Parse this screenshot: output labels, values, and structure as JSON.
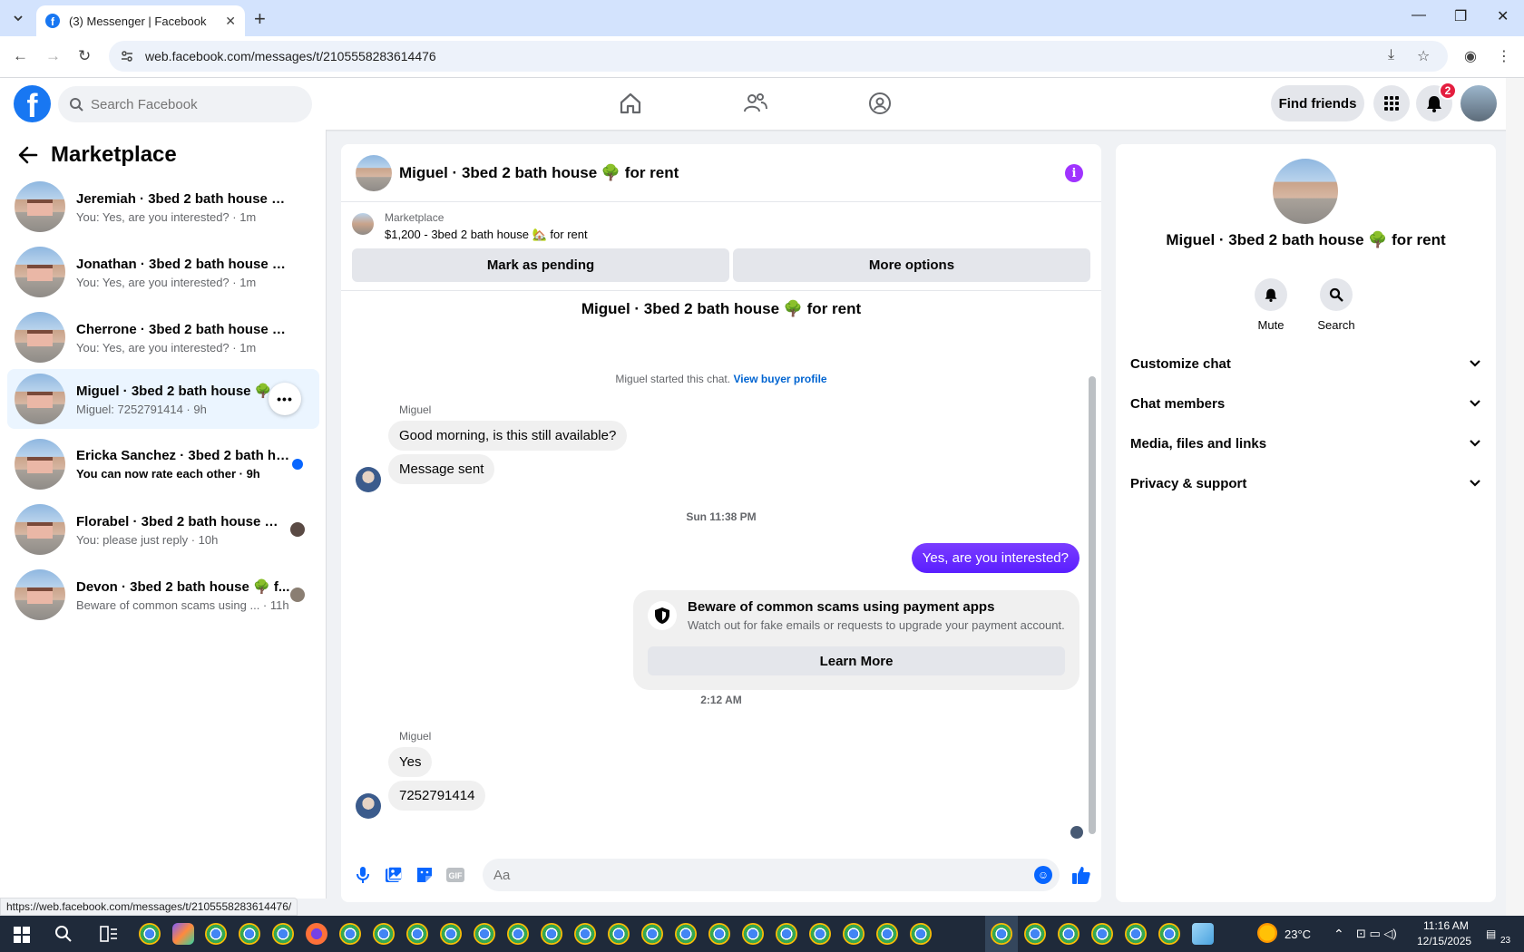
{
  "browser": {
    "tab_title": "(3) Messenger | Facebook",
    "url": "web.facebook.com/messages/t/2105558283614476",
    "status_url": "https://web.facebook.com/messages/t/2105558283614476/"
  },
  "fb": {
    "search_placeholder": "Search Facebook",
    "find_friends": "Find friends",
    "notif_count": "2"
  },
  "sidebar": {
    "title": "Marketplace",
    "conversations": [
      {
        "name": "Jeremiah · 3bed 2 bath house 🌳 f...",
        "sub": "You: Yes, are you interested? · 1m"
      },
      {
        "name": "Jonathan · 3bed 2 bath house 🌳 f...",
        "sub": "You: Yes, are you interested? · 1m"
      },
      {
        "name": "Cherrone · 3bed 2 bath house 🌳 f...",
        "sub": "You: Yes, are you interested? · 1m"
      },
      {
        "name": "Miguel · 3bed 2 bath house 🌳 f...",
        "sub": "Miguel: 7252791414 · 9h"
      },
      {
        "name": "Ericka Sanchez · 3bed 2 bath ho...",
        "sub": "You can now rate each other · 9h"
      },
      {
        "name": "Florabel · 3bed 2 bath house 🌳 ...",
        "sub": "You: please just reply · 10h"
      },
      {
        "name": "Devon · 3bed 2 bath house 🌳 f...",
        "sub": "Beware of common scams using ...  · 11h"
      }
    ]
  },
  "chat": {
    "title": "Miguel · 3bed 2 bath house 🌳 for rent",
    "listing_label": "Marketplace",
    "listing_price": "$1,200 - 3bed 2 bath house 🏡 for rent",
    "mark_pending": "Mark as pending",
    "more_options": "More options",
    "center_name": "Miguel · 3bed 2 bath house 🌳 for rent",
    "started": "Miguel started this chat.",
    "view_buyer": "View buyer profile",
    "sender1": "Miguel",
    "msg1": "Good morning, is this still available?",
    "msg2": "Message sent",
    "ts1": "Sun 11:38 PM",
    "out1": "Yes, are you interested?",
    "warn_title": "Beware of common scams using payment apps",
    "warn_desc": "Watch out for fake emails or requests to upgrade your payment account.",
    "learn_more": "Learn More",
    "ts2": "2:12 AM",
    "sender2": "Miguel",
    "msg3": "Yes",
    "msg4": "7252791414",
    "composer_placeholder": "Aa"
  },
  "right": {
    "name": "Miguel · 3bed 2 bath house 🌳 for rent",
    "mute": "Mute",
    "search": "Search",
    "sections": [
      "Customize chat",
      "Chat members",
      "Media, files and links",
      "Privacy & support"
    ]
  },
  "taskbar": {
    "temp": "23°C",
    "time": "11:16 AM",
    "date": "12/15/2025",
    "notif": "23"
  },
  "colors": {
    "fb_blue": "#1877f2",
    "accent_purple": "#6b2bff",
    "active_conv": "#ebf5ff"
  }
}
